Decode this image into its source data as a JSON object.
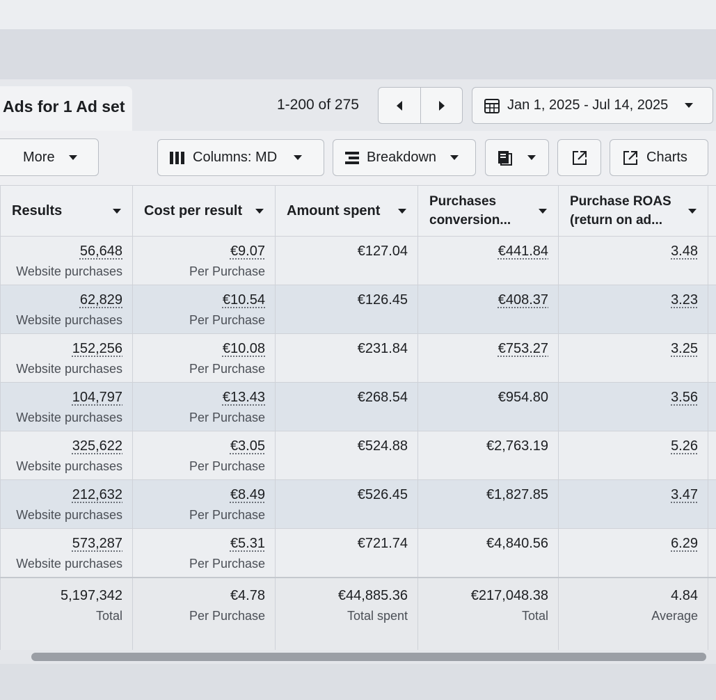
{
  "header": {
    "tab_title": "Ads for 1 Ad set",
    "pager_text": "1-200 of 275",
    "date_range": "Jan 1, 2025 - Jul 14, 2025"
  },
  "toolbar": {
    "more_label": "More",
    "columns_label": "Columns: MD",
    "breakdown_label": "Breakdown",
    "charts_label": "Charts"
  },
  "icons": {
    "prev": "chevron-left-icon",
    "next": "chevron-right-icon",
    "calendar": "calendar-icon",
    "columns": "columns-icon",
    "breakdown": "breakdown-icon",
    "report": "report-icon",
    "export": "export-icon",
    "charts": "charts-icon"
  },
  "table": {
    "columns": [
      {
        "label": "Results"
      },
      {
        "label": "Cost per result"
      },
      {
        "label": "Amount spent"
      },
      {
        "label": "Purchases\nconversion..."
      },
      {
        "label": "Purchase ROAS\n(return on ad..."
      }
    ],
    "rows": [
      {
        "results": "56,648",
        "results_sub": "Website purchases",
        "cost": "€9.07",
        "cost_sub": "Per Purchase",
        "spent": "€127.04",
        "conv": "€441.84",
        "roas": "3.48"
      },
      {
        "results": "62,829",
        "results_sub": "Website purchases",
        "cost": "€10.54",
        "cost_sub": "Per Purchase",
        "spent": "€126.45",
        "conv": "€408.37",
        "roas": "3.23"
      },
      {
        "results": "152,256",
        "results_sub": "Website purchases",
        "cost": "€10.08",
        "cost_sub": "Per Purchase",
        "spent": "€231.84",
        "conv": "€753.27",
        "roas": "3.25"
      },
      {
        "results": "104,797",
        "results_sub": "Website purchases",
        "cost": "€13.43",
        "cost_sub": "Per Purchase",
        "spent": "€268.54",
        "conv": "€954.80",
        "roas": "3.56"
      },
      {
        "results": "325,622",
        "results_sub": "Website purchases",
        "cost": "€3.05",
        "cost_sub": "Per Purchase",
        "spent": "€524.88",
        "conv": "€2,763.19",
        "roas": "5.26"
      },
      {
        "results": "212,632",
        "results_sub": "Website purchases",
        "cost": "€8.49",
        "cost_sub": "Per Purchase",
        "spent": "€526.45",
        "conv": "€1,827.85",
        "roas": "3.47"
      },
      {
        "results": "573,287",
        "results_sub": "Website purchases",
        "cost": "€5.31",
        "cost_sub": "Per Purchase",
        "spent": "€721.74",
        "conv": "€4,840.56",
        "roas": "6.29"
      }
    ],
    "totals": {
      "results": "5,197,342",
      "results_sub": "Total",
      "cost": "€4.78",
      "cost_sub": "Per Purchase",
      "spent": "€44,885.36",
      "spent_sub": "Total spent",
      "conv": "€217,048.38",
      "conv_sub": "Total",
      "roas": "4.84",
      "roas_sub": "Average"
    }
  },
  "colors": {
    "row_highlight": "#dde3ea",
    "row_normal": "#eceef1",
    "button_border": "#b9bdc4"
  }
}
